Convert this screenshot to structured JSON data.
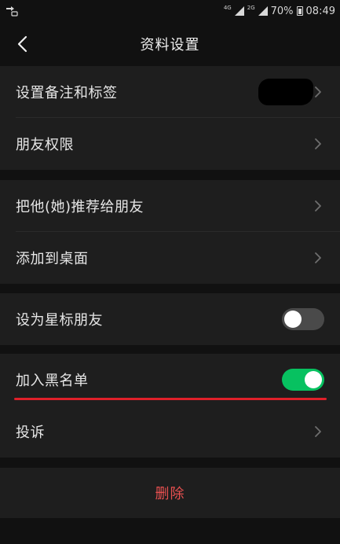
{
  "status_bar": {
    "net_type_1": "4G",
    "net_type_2": "2G",
    "battery": "70%",
    "time": "08:49"
  },
  "header": {
    "title": "资料设置"
  },
  "items": {
    "remark": "设置备注和标签",
    "permission": "朋友权限",
    "recommend": "把他(她)推荐给朋友",
    "desktop": "添加到桌面",
    "star": "设为星标朋友",
    "blacklist": "加入黑名单",
    "complain": "投诉",
    "delete": "删除"
  },
  "toggles": {
    "star_on": false,
    "blacklist_on": true
  },
  "colors": {
    "accent_green": "#07c160",
    "danger_red": "#e85050",
    "highlight_red": "#e0202a"
  }
}
